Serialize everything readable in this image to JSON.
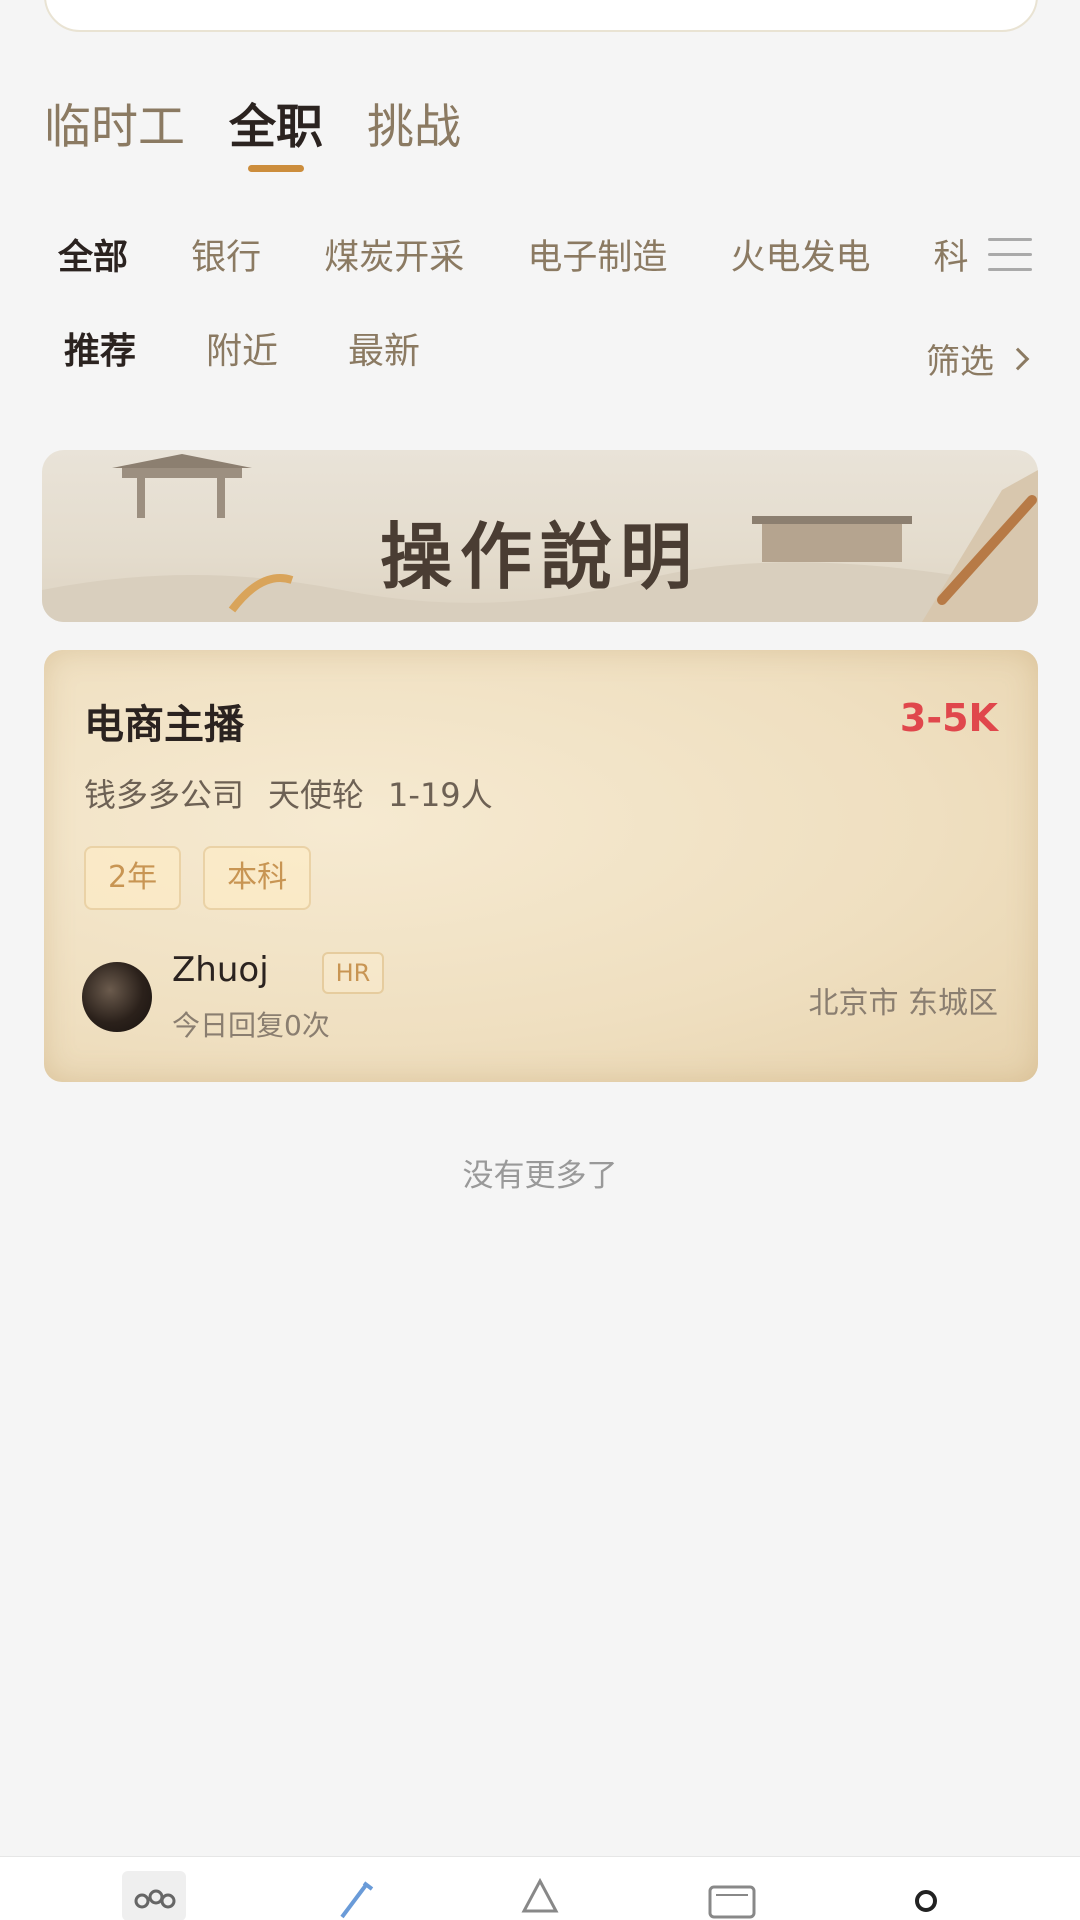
{
  "main_tabs": [
    "临时工",
    "全职",
    "挑战"
  ],
  "active_main_tab": "全职",
  "categories": [
    "全部",
    "银行",
    "煤炭开采",
    "电子制造",
    "火电发电",
    "科"
  ],
  "sort_options": [
    "推荐",
    "附近",
    "最新"
  ],
  "filter_label": "筛选",
  "banner_title": "操作說明",
  "job": {
    "title": "电商主播",
    "salary": "3-5K",
    "company": "钱多多公司",
    "funding": "天使轮",
    "size": "1-19人",
    "tags": [
      "2年",
      "本科"
    ],
    "recruiter_name": "Zhuoj",
    "recruiter_role": "HR",
    "reply_text": "今日回复0次",
    "location": "北京市 东城区"
  },
  "no_more_text": "没有更多了",
  "colors": {
    "accent": "#cc8d3c",
    "salary": "#e0474c",
    "muted_text": "#8b7a62"
  },
  "nav_icons": [
    "community-icon",
    "edit-icon",
    "home-icon",
    "scroll-icon",
    "profile-icon"
  ]
}
